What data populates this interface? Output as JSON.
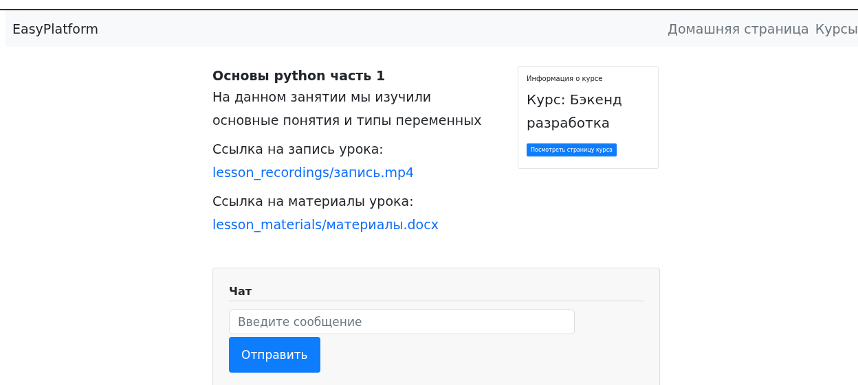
{
  "navbar": {
    "brand": "EasyPlatform",
    "links": [
      {
        "label": "Домашняя страница"
      },
      {
        "label": "Курсы"
      }
    ]
  },
  "lesson": {
    "title": "Основы python часть 1",
    "description": "На данном занятии мы изучили основные понятия и типы переменных",
    "resources": [
      {
        "label": "Ссылка на запись урока:",
        "link": "lesson_recordings/запись.mp4"
      },
      {
        "label": "Ссылка на материалы урока:",
        "link": "lesson_materials/материалы.docx"
      }
    ]
  },
  "course_card": {
    "heading": "Информация о курсе",
    "course": "Курс: Бэкенд разработка",
    "button": "Посмотреть страницу курса"
  },
  "chat": {
    "title": "Чат",
    "input": {
      "placeholder": "Введите сообщение"
    },
    "button": "Отправить"
  }
}
